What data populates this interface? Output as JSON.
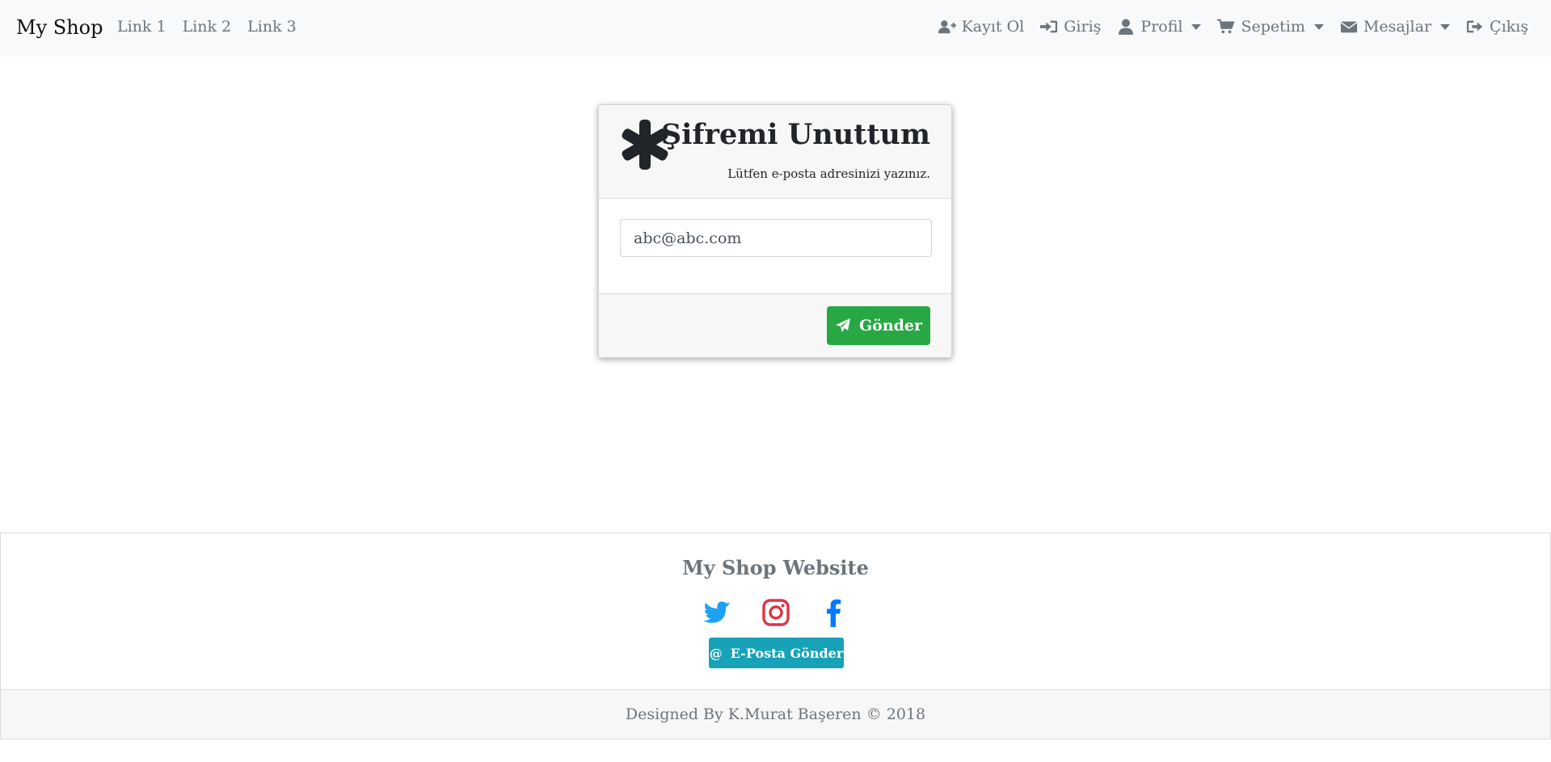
{
  "navbar": {
    "brand": "My Shop",
    "links": [
      "Link 1",
      "Link 2",
      "Link 3"
    ],
    "right_items": [
      {
        "label": "Kayıt Ol",
        "icon": "user-plus-icon",
        "dropdown": false
      },
      {
        "label": "Giriş",
        "icon": "sign-in-icon",
        "dropdown": false
      },
      {
        "label": "Profil",
        "icon": "user-icon",
        "dropdown": true
      },
      {
        "label": "Sepetim",
        "icon": "cart-icon",
        "dropdown": true
      },
      {
        "label": "Mesajlar",
        "icon": "envelope-icon",
        "dropdown": true
      },
      {
        "label": "Çıkış",
        "icon": "sign-out-icon",
        "dropdown": false
      }
    ]
  },
  "card": {
    "icon": "asterisk-icon",
    "title": "Şifremi Unuttum",
    "subtitle": "Lütfen e-posta adresinizi yazınız.",
    "email_placeholder": "abc@abc.com",
    "send_label": "Gönder"
  },
  "footer": {
    "title": "My Shop Website",
    "socials": [
      "twitter-icon",
      "instagram-icon",
      "facebook-icon"
    ],
    "mail_symbol": "@",
    "mail_label": "E-Posta Gönder",
    "copyright": "Designed By K.Murat Başeren © 2018"
  },
  "colors": {
    "navbar_bg": "#f8f9fa",
    "success": "#28a745",
    "info": "#17a2b8",
    "twitter": "#1da1f2",
    "instagram": "#dc3545",
    "facebook": "#007bff",
    "muted": "#6c757d"
  }
}
